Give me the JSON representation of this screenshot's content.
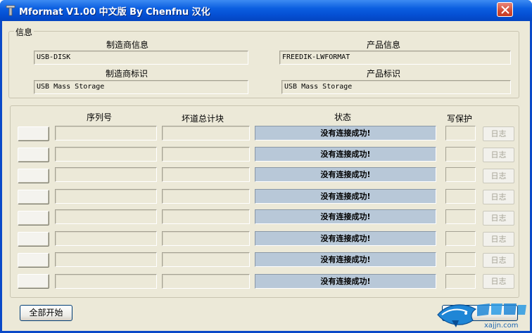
{
  "window": {
    "title": "Mformat V1.00 中文版 By Chenfnu 汉化"
  },
  "info": {
    "group_title": "信息",
    "manufacturer_info_label": "制造商信息",
    "manufacturer_info_value": "USB-DISK",
    "product_info_label": "产品信息",
    "product_info_value": "FREEDIK-LWFORMAT",
    "manufacturer_id_label": "制造商标识",
    "manufacturer_id_value": "USB Mass Storage",
    "product_id_label": "产品标识",
    "product_id_value": "USB Mass Storage"
  },
  "table": {
    "headers": {
      "serial": "序列号",
      "bad_blocks": "坏道总计块",
      "status": "状态",
      "write_protect": "写保护"
    },
    "rows": [
      {
        "status": "没有连接成功!",
        "log": "日志"
      },
      {
        "status": "没有连接成功!",
        "log": "日志"
      },
      {
        "status": "没有连接成功!",
        "log": "日志"
      },
      {
        "status": "没有连接成功!",
        "log": "日志"
      },
      {
        "status": "没有连接成功!",
        "log": "日志"
      },
      {
        "status": "没有连接成功!",
        "log": "日志"
      },
      {
        "status": "没有连接成功!",
        "log": "日志"
      },
      {
        "status": "没有连接成功!",
        "log": "日志"
      }
    ]
  },
  "footer": {
    "start_all": "全部开始"
  },
  "watermark": {
    "text": "xajjn.com"
  }
}
